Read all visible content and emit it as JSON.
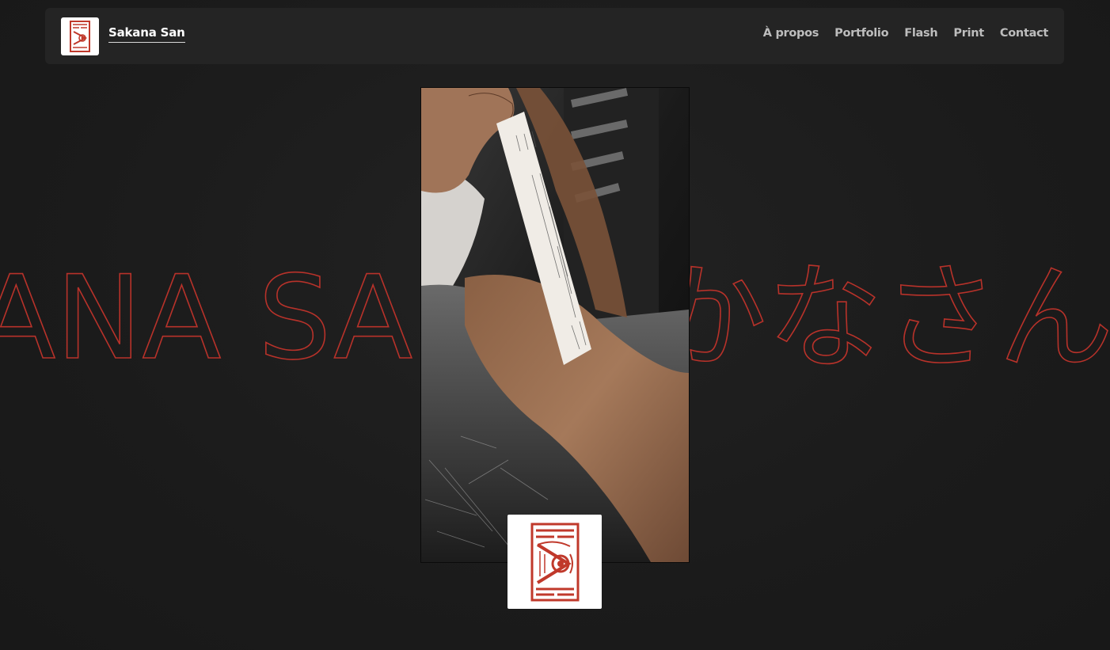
{
  "brand": {
    "name": "Sakana San",
    "logo_icon": "sakana-seal-logo-icon"
  },
  "nav": {
    "items": [
      "À propos",
      "Portfolio",
      "Flash",
      "Print",
      "Contact"
    ]
  },
  "hero": {
    "outline_text": "SAKANA SAN さかなさん",
    "media_description_icon": "tattoo-video-frame",
    "stamp_icon": "sakana-seal-stamp-icon"
  },
  "colors": {
    "background": "#1c1c1c",
    "header": "#242424",
    "accent_red": "#b8322a",
    "nav_text": "#bdbdbd"
  }
}
